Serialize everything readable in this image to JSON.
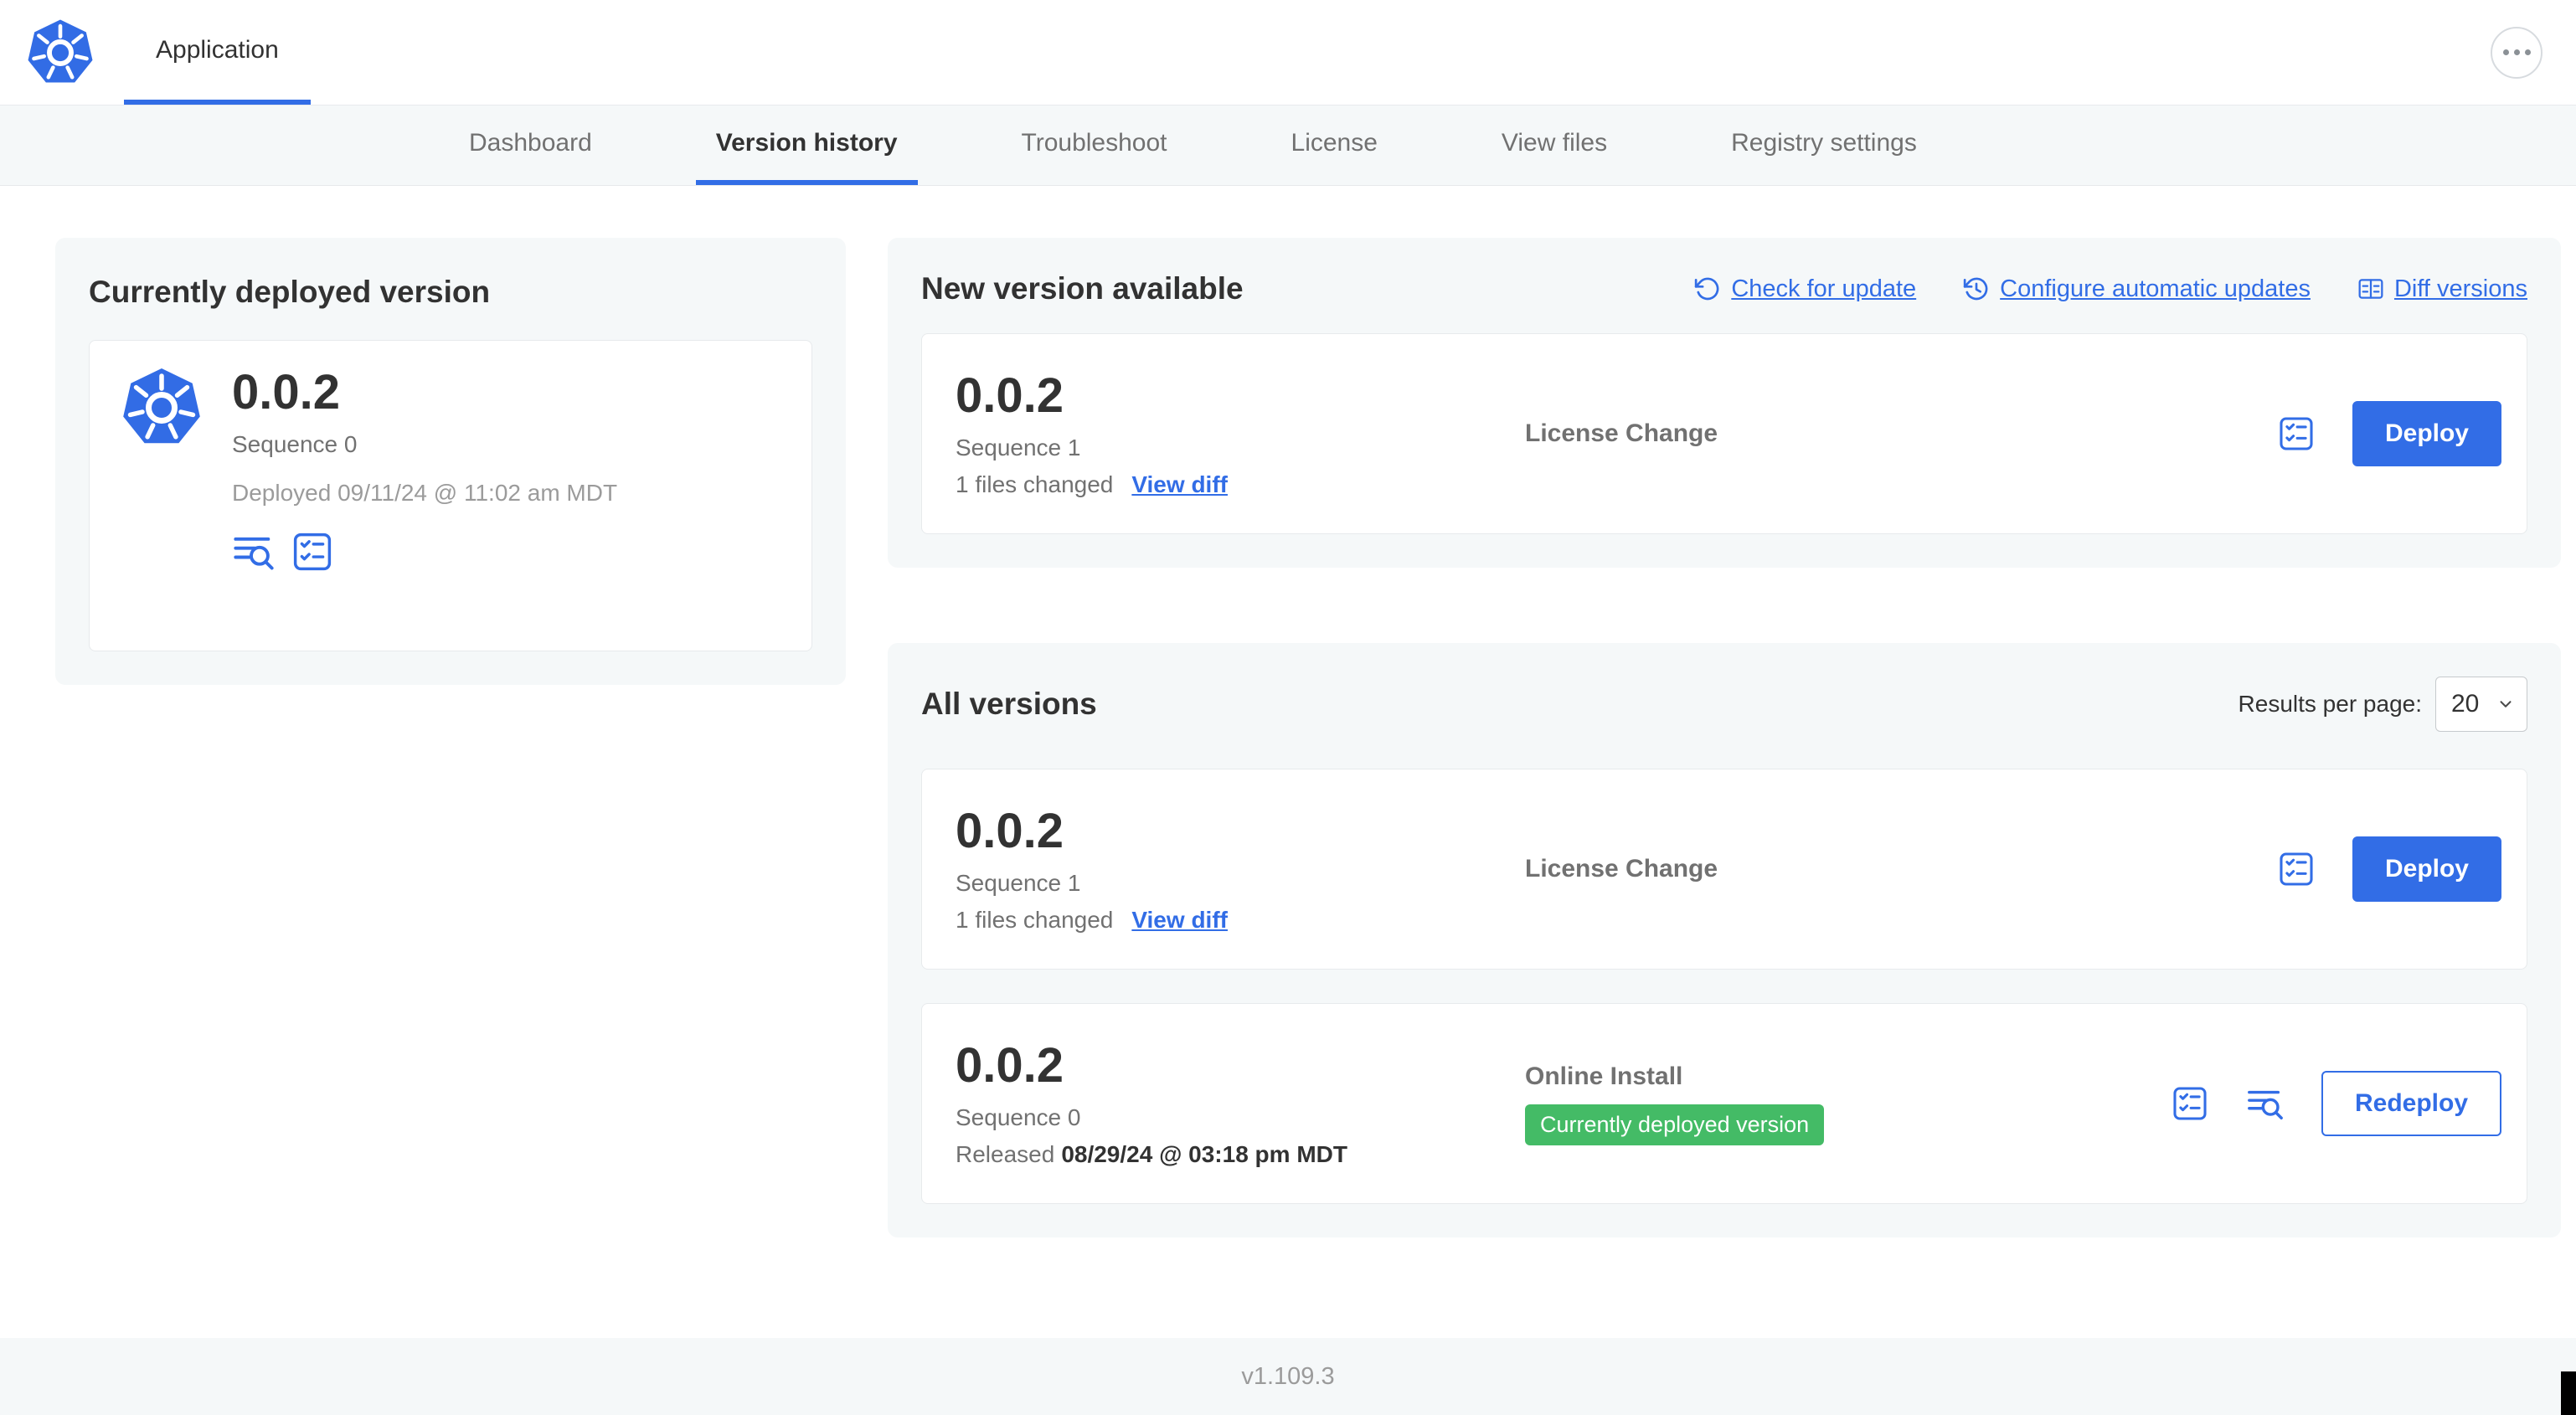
{
  "colors": {
    "primary": "#326de6",
    "badge_green": "#44bb66",
    "panel_bg": "#f5f8f9"
  },
  "topbar": {
    "app_tab": "Application"
  },
  "nav": {
    "tabs": [
      "Dashboard",
      "Version history",
      "Troubleshoot",
      "License",
      "View files",
      "Registry settings"
    ],
    "active": "Version history"
  },
  "deployed": {
    "heading": "Currently deployed version",
    "version": "0.0.2",
    "sequence": "Sequence 0",
    "deployed_at": "Deployed 09/11/24 @ 11:02 am MDT"
  },
  "new_version": {
    "heading": "New version available",
    "check_for_update": "Check for update",
    "configure_auto": "Configure automatic updates",
    "diff_versions": "Diff versions",
    "row": {
      "version": "0.0.2",
      "sequence": "Sequence 1",
      "files_changed": "1 files changed",
      "view_diff": "View diff",
      "source": "License Change",
      "action": "Deploy"
    }
  },
  "all_versions": {
    "heading": "All versions",
    "results_label": "Results per page:",
    "results_value": "20",
    "rows": [
      {
        "version": "0.0.2",
        "sequence": "Sequence 1",
        "files_changed": "1 files changed",
        "view_diff": "View diff",
        "source": "License Change",
        "action": "Deploy"
      },
      {
        "version": "0.0.2",
        "sequence": "Sequence 0",
        "released_prefix": "Released",
        "released_date": "08/29/24 @ 03:18 pm MDT",
        "source": "Online Install",
        "badge": "Currently deployed version",
        "action": "Redeploy"
      }
    ]
  },
  "footer": {
    "version": "v1.109.3"
  }
}
